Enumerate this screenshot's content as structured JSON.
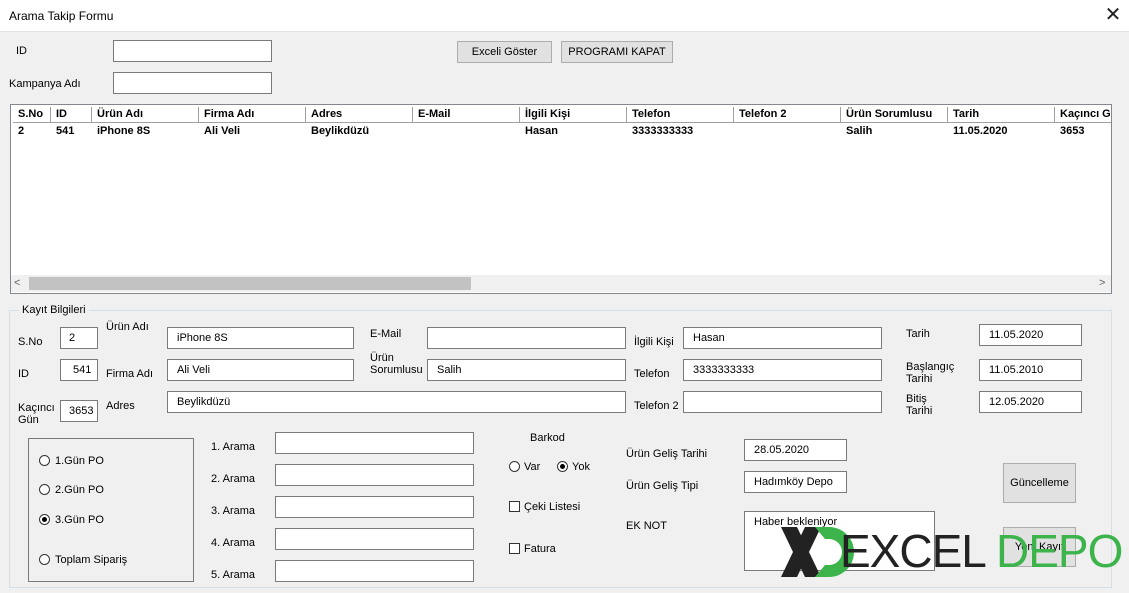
{
  "window": {
    "title": "Arama Takip Formu"
  },
  "top": {
    "id_label": "ID",
    "id_value": "",
    "campaign_label": "Kampanya Adı",
    "campaign_value": "",
    "excel_button": "Exceli Göster",
    "close_program_button": "PROGRAMI KAPAT"
  },
  "list": {
    "columns": [
      "S.No",
      "ID",
      "Ürün Adı",
      "Firma Adı",
      "Adres",
      "E-Mail",
      "İlgili Kişi",
      "Telefon",
      "Telefon 2",
      "Ürün Sorumlusu",
      "Tarih",
      "Kaçıncı G"
    ],
    "rows": [
      [
        "2",
        "541",
        "iPhone 8S",
        "Ali Veli",
        "Beylikdüzü",
        "",
        "Hasan",
        "3333333333",
        "",
        "Salih",
        "11.05.2020",
        "3653"
      ]
    ],
    "scroll_left": "<",
    "scroll_right": ">"
  },
  "form": {
    "group_title": "Kayıt Bilgileri",
    "sno_label": "S.No",
    "sno_value": "2",
    "id_label": "ID",
    "id_value": "541",
    "day_label_1": "Kaçıncı",
    "day_label_2": "Gün",
    "day_value": "3653",
    "product_label": "Ürün Adı",
    "product_value": "iPhone 8S",
    "company_label": "Firma Adı",
    "company_value": "Ali Veli",
    "address_label": "Adres",
    "address_value": "Beylikdüzü",
    "email_label": "E-Mail",
    "email_value": "",
    "owner_label_1": "Ürün",
    "owner_label_2": "Sorumlusu",
    "owner_value": "Salih",
    "contact_label": "İlgili Kişi",
    "contact_value": "Hasan",
    "phone_label": "Telefon",
    "phone_value": "3333333333",
    "phone2_label": "Telefon 2",
    "phone2_value": "",
    "date_label": "Tarih",
    "date_value": "11.05.2020",
    "start_label_1": "Başlangıç",
    "start_label_2": "Tarihi",
    "start_value": "11.05.2010",
    "end_label_1": "Bitiş",
    "end_label_2": "Tarihi",
    "end_value": "12.05.2020"
  },
  "po": {
    "options": [
      "1.Gün PO",
      "2.Gün PO",
      "3.Gün PO",
      "Toplam Sipariş"
    ],
    "selected": "3.Gün PO"
  },
  "calls": {
    "labels": [
      "1. Arama",
      "2. Arama",
      "3. Arama",
      "4. Arama",
      "5. Arama"
    ],
    "values": [
      "",
      "",
      "",
      "",
      ""
    ]
  },
  "barcode": {
    "label": "Barkod",
    "yes_label": "Var",
    "no_label": "Yok",
    "selected": "Yok"
  },
  "checks": {
    "packing_list_label": "Çeki Listesi",
    "packing_list_checked": false,
    "invoice_label": "Fatura",
    "invoice_checked": false
  },
  "arrival": {
    "date_label": "Ürün Geliş Tarihi",
    "date_value": "28.05.2020",
    "type_label": "Ürün Geliş Tipi",
    "type_value": "Hadımköy Depo",
    "note_label": "EK NOT",
    "note_value": "Haber bekleniyor"
  },
  "actions": {
    "update_button": "Güncelleme",
    "new_record_button": "Yeni Kayıt"
  },
  "watermark": {
    "text": "XDEXCELDEPO",
    "green": "#3cb44b"
  }
}
